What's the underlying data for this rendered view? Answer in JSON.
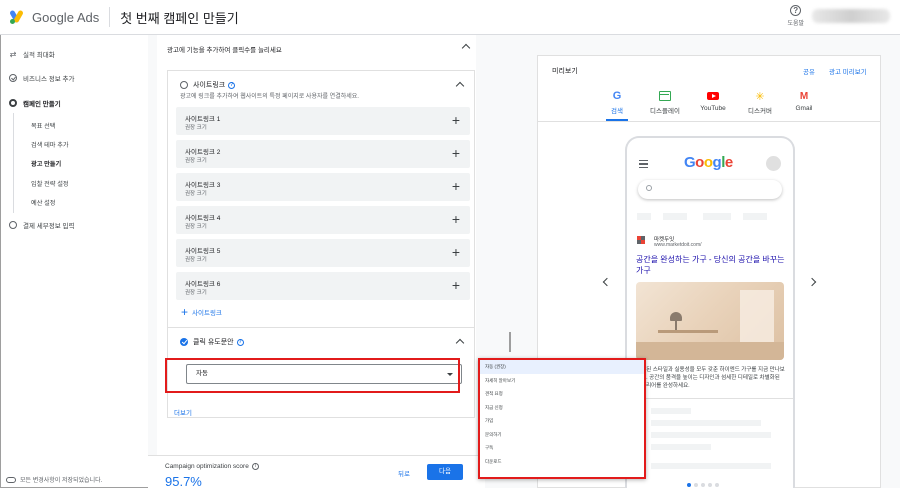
{
  "header": {
    "product": "Google Ads",
    "title": "첫 번째 캠페인 만들기",
    "help_label": "도움말"
  },
  "sidebar": {
    "items": [
      {
        "label": "실적 최대화"
      },
      {
        "label": "비즈니스 정보 추가"
      },
      {
        "label": "캠페인 만들기"
      },
      {
        "label": "결제 세부정보 입력"
      }
    ],
    "subitems": [
      {
        "label": "목표 선택"
      },
      {
        "label": "검색 테마 추가"
      },
      {
        "label": "광고 만들기"
      },
      {
        "label": "입찰 전략 설정"
      },
      {
        "label": "예산 설정"
      }
    ],
    "footer": "모든 변경사항이 저장되었습니다."
  },
  "main": {
    "panel_heading": "광고에 기능을 추가하여 클릭수를 늘리세요",
    "sitelinks": {
      "title": "사이트링크",
      "description": "광고에 링크를 추가하여 웹사이트의 특정 페이지로 사용자를 연결하세요.",
      "items": [
        {
          "label": "사이트링크 1",
          "sub": "권장 크기"
        },
        {
          "label": "사이트링크 2",
          "sub": "권장 크기"
        },
        {
          "label": "사이트링크 3",
          "sub": "권장 크기"
        },
        {
          "label": "사이트링크 4",
          "sub": "권장 크기"
        },
        {
          "label": "사이트링크 5",
          "sub": "권장 크기"
        },
        {
          "label": "사이트링크 6",
          "sub": "권장 크기"
        }
      ],
      "add_label": "사이트링크"
    },
    "cta": {
      "title": "클릭 유도문안",
      "selected": "자동"
    },
    "more_label": "더보기",
    "score": {
      "label": "Campaign optimization score",
      "value": "95.7%"
    },
    "back_label": "뒤로",
    "next_label": "다음"
  },
  "dropdown": {
    "options": [
      "자동 (권장)",
      "자세히 알아보기",
      "견적 요청",
      "지금 신청",
      "가입",
      "문의하기",
      "구독",
      "다운로드"
    ],
    "selected_index": 0
  },
  "preview": {
    "title": "미리보기",
    "share_label": "공유",
    "ad_preview_label": "광고 미리보기",
    "tabs": [
      {
        "label": "검색",
        "icon": "google-g-icon"
      },
      {
        "label": "디스플레이",
        "icon": "display-icon"
      },
      {
        "label": "YouTube",
        "icon": "youtube-icon"
      },
      {
        "label": "디스커버",
        "icon": "discover-icon"
      },
      {
        "label": "Gmail",
        "icon": "gmail-icon"
      }
    ],
    "active_tab": 0,
    "ad": {
      "advertiser": "마켓두잇",
      "url": "www.marketdoit.com/",
      "headline": "공간을 완성하는 가구 - 당신의 공간을 바꾸는 가구",
      "description": "세련된 스타일과 실용성을 모두 갖춘 하이엔드 가구를 지금 만나보세요. 공간의 품격을 높이는 디자인과 섬세한 디테일로 차별화된 인테리어를 완성하세요."
    },
    "logo_text": "Google"
  },
  "colors": {
    "accent": "#1a73e8",
    "highlight": "#e21b1b"
  }
}
